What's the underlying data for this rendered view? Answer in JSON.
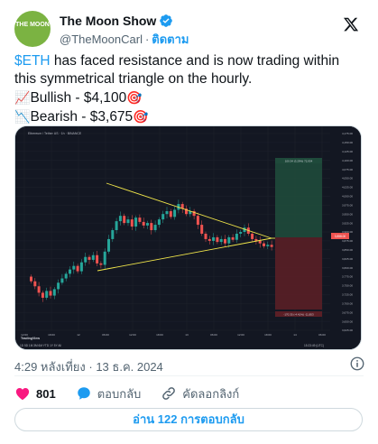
{
  "author": {
    "avatar_text": "THE MOON",
    "display_name": "The Moon Show",
    "handle": "@TheMoonCarl",
    "follow_label": "ติดตาม"
  },
  "tweet": {
    "cashtag": "$ETH",
    "line1_rest": " has faced resistance and is now trading within this symmetrical triangle on the hourly.",
    "bullish_label": "Bullish - $4,100",
    "bearish_label": "Bearish - $3,675"
  },
  "chart_data": {
    "type": "candlestick",
    "symbol_label": "Ethereum / Tether US · 1h · BINANCE",
    "y_ticks": [
      "4,175.00",
      "4,150.00",
      "4,125.00",
      "4,100.00",
      "4,075.00",
      "4,050.00",
      "4,025.00",
      "4,000.00",
      "3,975.00",
      "3,950.00",
      "3,925.00",
      "3,900.00",
      "3,875.00",
      "3,850.00",
      "3,825.00",
      "3,800.00",
      "3,775.00",
      "3,750.00",
      "3,725.00",
      "3,700.00",
      "3,675.00",
      "3,650.00",
      "3,625.00"
    ],
    "x_ticks": [
      "12:00",
      "18:00",
      "12",
      "06:00",
      "12:00",
      "18:00",
      "13",
      "06:00",
      "12:00",
      "18:00",
      "14",
      "06:00"
    ],
    "current_price": "3,858.00",
    "target_label": "100.34 (3.29%) 72,934",
    "stop_label": "-170.35 (-4.41%) -11,853",
    "footer_left": "1D 5D 1M 3M 6M YTD 1Y 5Y All",
    "footer_right": "15:23:49 (UTC)",
    "tradingview_label": "TradingView"
  },
  "timestamp": "4:29 หลังเที่ยง · 13 ธ.ค. 2024",
  "actions": {
    "likes": "801",
    "reply_label": "ตอบกลับ",
    "copy_link_label": "คัดลอกลิงก์"
  },
  "read_replies_label": "อ่าน 122 การตอบกลับ",
  "colors": {
    "accent": "#1d9bf0",
    "like": "#f91880",
    "up": "#26a69a",
    "down": "#ef5350"
  }
}
